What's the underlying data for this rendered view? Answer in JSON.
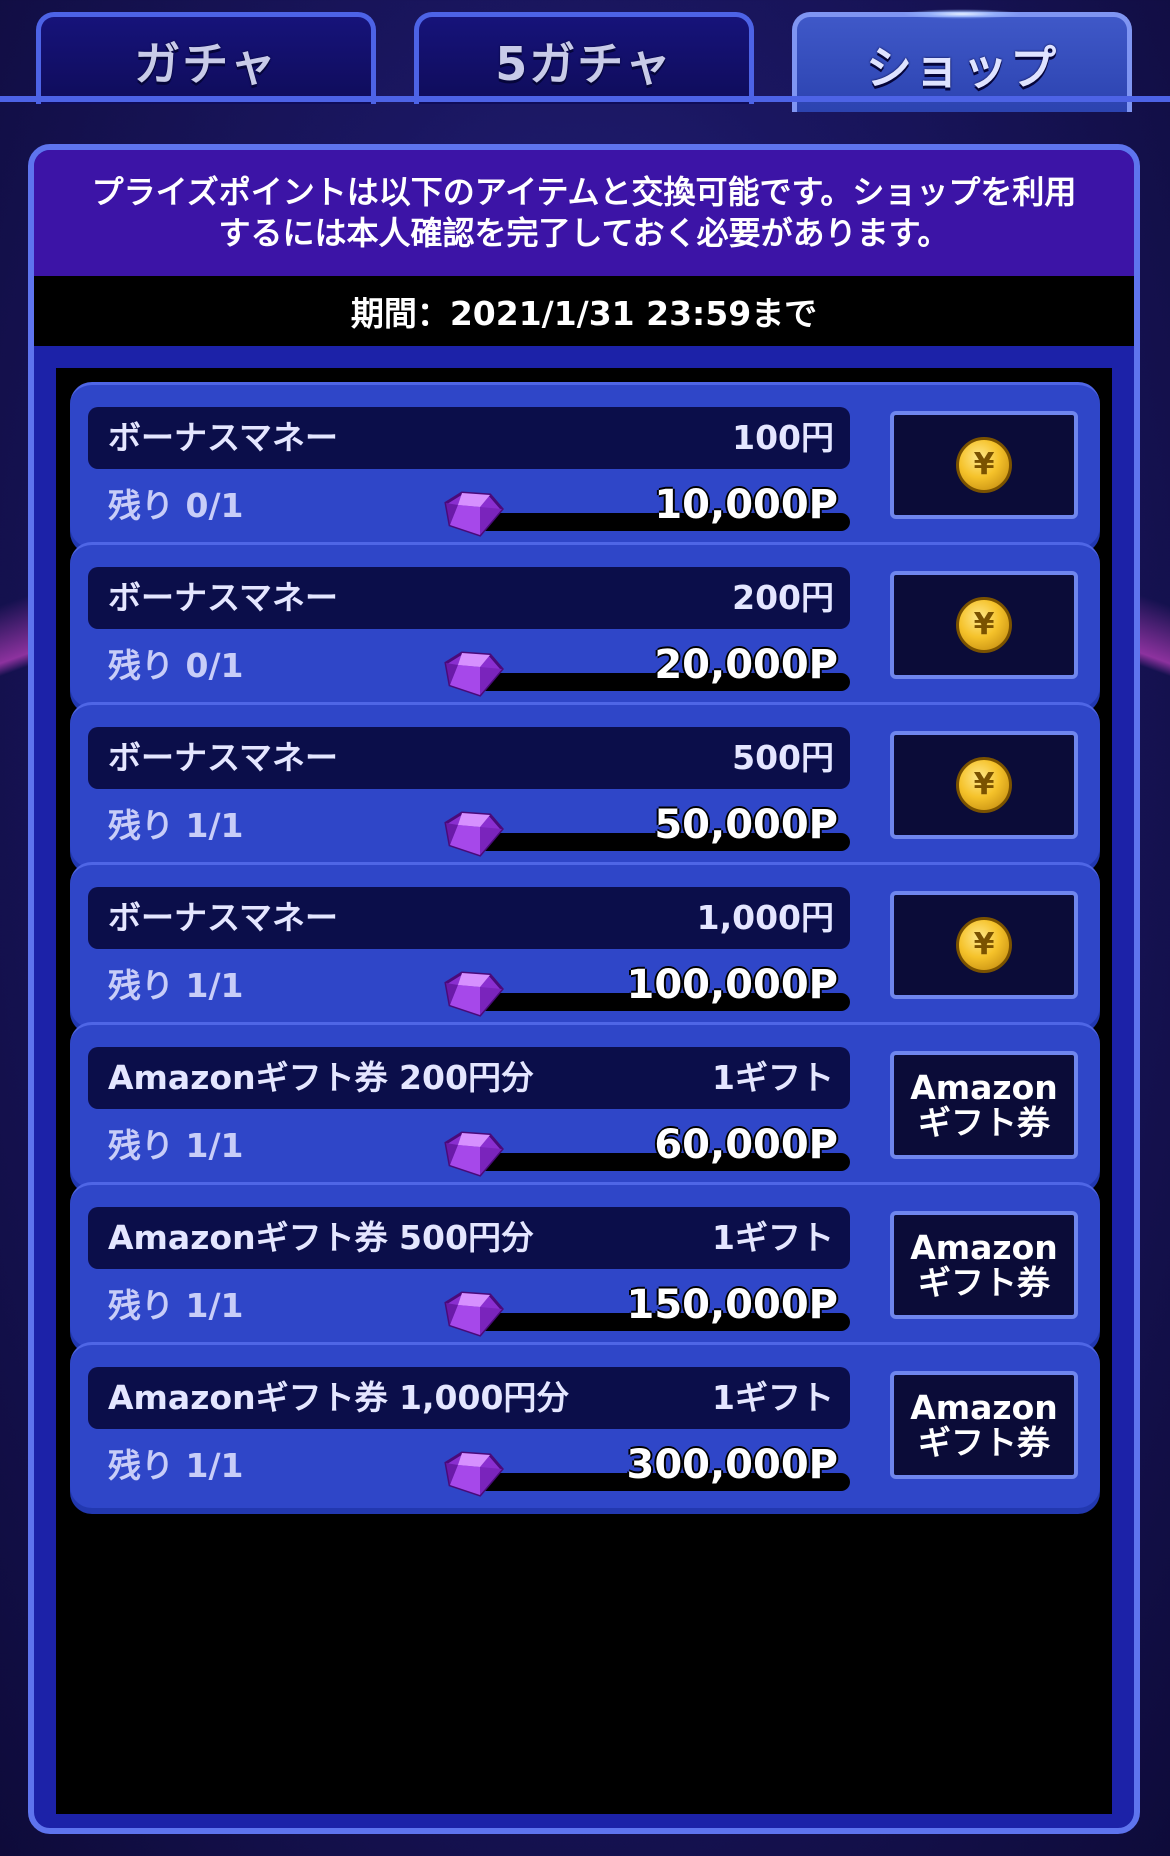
{
  "tabs": [
    {
      "label": "ガチャ"
    },
    {
      "label": "5ガチャ"
    },
    {
      "label": "ショップ"
    }
  ],
  "notice": {
    "line1": "プライズポイントは以下のアイテムと交換可能です。ショップを利用",
    "line2": "するには本人確認を完了しておく必要があります。"
  },
  "period": "期間：2021/1/31 23:59まで",
  "items": [
    {
      "name": "ボーナスマネー",
      "qty": "100円",
      "remain": "残り 0/1",
      "price": "10,000P",
      "button": "",
      "icon": "yen-coin-icon"
    },
    {
      "name": "ボーナスマネー",
      "qty": "200円",
      "remain": "残り 0/1",
      "price": "20,000P",
      "button": "",
      "icon": "yen-coin-icon"
    },
    {
      "name": "ボーナスマネー",
      "qty": "500円",
      "remain": "残り 1/1",
      "price": "50,000P",
      "button": "",
      "icon": "yen-coin-icon"
    },
    {
      "name": "ボーナスマネー",
      "qty": "1,000円",
      "remain": "残り 1/1",
      "price": "100,000P",
      "button": "",
      "icon": "yen-coin-icon"
    },
    {
      "name": "Amazonギフト券 200円分",
      "qty": "1ギフト",
      "remain": "残り 1/1",
      "price": "60,000P",
      "button": "Amazon\nギフト券",
      "icon": ""
    },
    {
      "name": "Amazonギフト券 500円分",
      "qty": "1ギフト",
      "remain": "残り 1/1",
      "price": "150,000P",
      "button": "Amazon\nギフト券",
      "icon": ""
    },
    {
      "name": "Amazonギフト券 1,000円分",
      "qty": "1ギフト",
      "remain": "残り 1/1",
      "price": "300,000P",
      "button": "Amazon\nギフト券",
      "icon": ""
    }
  ],
  "coin_symbol": "¥",
  "colors": {
    "panel": "#1c22a8",
    "card": "#2f46c8",
    "notice_bg": "#3c14a6",
    "gem": "#a040e0",
    "coin": "#f5c22a"
  }
}
